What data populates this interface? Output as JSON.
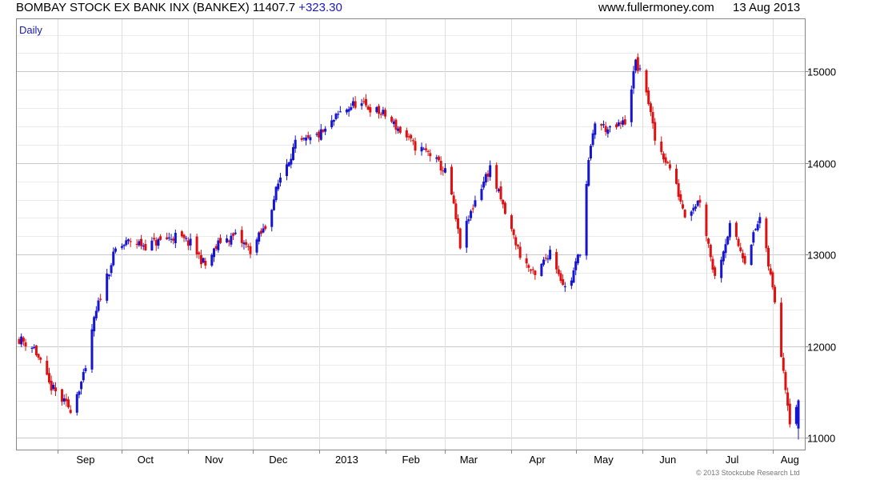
{
  "header": {
    "title": "BOMBAY STOCK EX BANK INX (BANKEX)",
    "last": "11407.7",
    "change": "+323.30",
    "source": "www.fullermoney.com",
    "date": "13 Aug 2013"
  },
  "footer": {
    "copyright": "© 2013 Stockcube Research Ltd"
  },
  "colors": {
    "up": "#1414d2",
    "down": "#e01010",
    "grid": "#d9d9d9",
    "frame": "#888888",
    "label": "#1a1ab8"
  },
  "chart_data": {
    "type": "candlestick",
    "label": "Daily",
    "y_axis": {
      "side": "right",
      "ticks": [
        11000,
        12000,
        13000,
        14000,
        15000
      ],
      "range": [
        10870,
        15580
      ],
      "minor_step": 200
    },
    "x_axis": {
      "start": "2012-08-14",
      "end": "2013-08-13",
      "labels": [
        {
          "text": "Sep",
          "at": "2012-09-14"
        },
        {
          "text": "Oct",
          "at": "2012-10-12"
        },
        {
          "text": "Nov",
          "at": "2012-11-13"
        },
        {
          "text": "Dec",
          "at": "2012-12-13"
        },
        {
          "text": "2013",
          "at": "2013-01-14"
        },
        {
          "text": "Feb",
          "at": "2013-02-13"
        },
        {
          "text": "Mar",
          "at": "2013-03-12"
        },
        {
          "text": "Apr",
          "at": "2013-04-13"
        },
        {
          "text": "May",
          "at": "2013-05-14"
        },
        {
          "text": "Jun",
          "at": "2013-06-13"
        },
        {
          "text": "Jul",
          "at": "2013-07-13"
        },
        {
          "text": "Aug",
          "at": "2013-08-09"
        }
      ],
      "month_boundaries": [
        "2012-09-01",
        "2012-10-01",
        "2012-11-01",
        "2012-12-01",
        "2013-01-01",
        "2013-02-01",
        "2013-03-01",
        "2013-04-01",
        "2013-05-01",
        "2013-06-01",
        "2013-07-01",
        "2013-08-01"
      ]
    },
    "close_series": [
      [
        "2012-08-14",
        12080
      ],
      [
        "2012-08-21",
        11980
      ],
      [
        "2012-08-28",
        11580
      ],
      [
        "2012-09-04",
        11380
      ],
      [
        "2012-09-07",
        11320
      ],
      [
        "2012-09-14",
        11720
      ],
      [
        "2012-09-17",
        12180
      ],
      [
        "2012-09-21",
        12550
      ],
      [
        "2012-09-28",
        13050
      ],
      [
        "2012-10-05",
        13150
      ],
      [
        "2012-10-12",
        13100
      ],
      [
        "2012-10-19",
        13150
      ],
      [
        "2012-10-26",
        13200
      ],
      [
        "2012-11-02",
        13120
      ],
      [
        "2012-11-09",
        12880
      ],
      [
        "2012-11-16",
        13150
      ],
      [
        "2012-11-23",
        13200
      ],
      [
        "2012-11-30",
        13050
      ],
      [
        "2012-12-07",
        13300
      ],
      [
        "2012-12-14",
        13850
      ],
      [
        "2012-12-21",
        14200
      ],
      [
        "2012-12-28",
        14250
      ],
      [
        "2013-01-04",
        14350
      ],
      [
        "2013-01-11",
        14550
      ],
      [
        "2013-01-18",
        14650
      ],
      [
        "2013-01-25",
        14600
      ],
      [
        "2013-02-01",
        14520
      ],
      [
        "2013-02-08",
        14350
      ],
      [
        "2013-02-15",
        14180
      ],
      [
        "2013-02-22",
        14100
      ],
      [
        "2013-03-01",
        13900
      ],
      [
        "2013-03-04",
        13650
      ],
      [
        "2013-03-08",
        13100
      ],
      [
        "2013-03-15",
        13600
      ],
      [
        "2013-03-22",
        13950
      ],
      [
        "2013-03-29",
        13450
      ],
      [
        "2013-04-05",
        13000
      ],
      [
        "2013-04-12",
        12750
      ],
      [
        "2013-04-19",
        13050
      ],
      [
        "2013-04-24",
        12750
      ],
      [
        "2013-04-27",
        12580
      ],
      [
        "2013-05-03",
        13050
      ],
      [
        "2013-05-07",
        14000
      ],
      [
        "2013-05-10",
        14450
      ],
      [
        "2013-05-17",
        14350
      ],
      [
        "2013-05-24",
        14450
      ],
      [
        "2013-05-29",
        15100
      ],
      [
        "2013-06-03",
        14800
      ],
      [
        "2013-06-07",
        14250
      ],
      [
        "2013-06-14",
        13950
      ],
      [
        "2013-06-21",
        13450
      ],
      [
        "2013-06-28",
        13600
      ],
      [
        "2013-07-05",
        12750
      ],
      [
        "2013-07-12",
        13300
      ],
      [
        "2013-07-19",
        12950
      ],
      [
        "2013-07-26",
        13400
      ],
      [
        "2013-08-02",
        12500
      ],
      [
        "2013-08-06",
        11750
      ],
      [
        "2013-08-09",
        11200
      ],
      [
        "2013-08-13",
        11400
      ]
    ],
    "last_candle": {
      "date": "2013-08-13",
      "open": 11100,
      "high": 11420,
      "low": 10980,
      "close": 11407.7
    }
  }
}
